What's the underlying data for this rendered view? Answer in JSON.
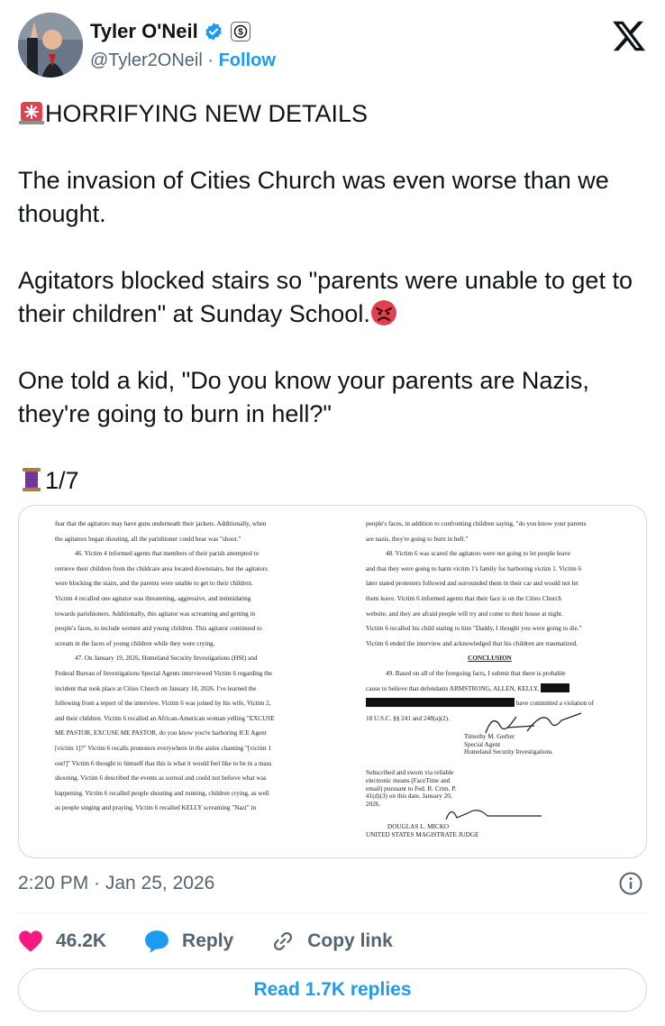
{
  "author": {
    "display_name": "Tyler O'Neil",
    "handle": "@Tyler2ONeil",
    "separator": "·",
    "follow_label": "Follow"
  },
  "tweet": {
    "line1": "HORRIFYING NEW DETAILS",
    "para2": "The invasion of Cities Church was even worse than we thought.",
    "para3": "Agitators blocked stairs so \"parents were unable to get to their children\" at Sunday School.",
    "para4": "One told a kid, \"Do you know your parents are Nazis, they're going to burn in hell?\"",
    "thread": "1/7"
  },
  "document": {
    "left": [
      "fear that the agitators may have guns underneath their jackets.  Additionally, when",
      "the agitators began shouting, all the parishioner could hear was \"shoot.\"",
      "46.   Victim 4 informed agents that members of their parish attempted to",
      "retrieve their children from the childcare area located downstairs, but the agitators",
      "were blocking the stairs, and the parents were unable to get to their children.",
      "Victim 4 recalled one agitator was threatening, aggressive, and intimidating",
      "towards parishioners.  Additionally, this agitator was screaming and getting in",
      "people's faces, to include women and young children.  This agitator continued to",
      "scream in the faces of young children while they were crying.",
      "47.   On January 19, 2026, Homeland Security Investigations (HSI) and",
      "Federal Bureau of Investigations Special Agents interviewed Victim 6 regarding the",
      "incident that took place at Cities Church on January 18, 2026.  I've learned the",
      "following from a report of the interview.  Victim 6 was joined by his wife, Victim 2,",
      "and their children.  Victim 6 recalled an African-American woman yelling \"EXCUSE",
      "ME PASTOR, EXCUSE ME PASTOR, do you know you're harboring ICE Agent",
      "[victim 1]?\"  Victim 6 recalls protesters everywhere in the aisles chanting \"[victim 1",
      "out!]\"  Victim 6 thought to himself that this is what it would feel like to be in a mass",
      "shooting.  Victim 6 described the events as surreal and could not believe what was",
      "happening.  Victim 6 recalled people shouting and running, children crying, as well",
      "as people singing and praying.  Victim 6 recalled KELLY screaming \"Nazi\" in"
    ],
    "right": [
      "people's faces, in addition to confronting children saying, \"do you know your parents",
      "are nazis, they're going to burn in hell.\"",
      "48.   Victim 6 was scared the agitators were not going to let people leave",
      "and that they were going to harm victim 1's family for harboring victim 1.  Victim 6",
      "later stated protesters followed and surrounded them in their car and would not let",
      "them leave.  Victim 6 informed agents that their face is on the Cities Church",
      "website, and they are afraid people will try and come to their house at night.",
      "Victim 6 recalled his child stating to him \"Daddy, I thought you were going to die.\"",
      "Victim 6 ended the interview and acknowledged that his children are traumatized."
    ],
    "conclusion_heading": "CONCLUSION",
    "para49_a": "49.   Based on all of the foregoing facts, I submit that there is probable",
    "para49_b": "cause to believe that defendants ARMSTRONG, ALLEN, KELLY,",
    "para49_c": "have committed a violation of",
    "para49_d": "18 U.S.C. §§ 241 and 248(a)(2).",
    "signer_name": "Timothy M. Gerber",
    "signer_title": "Special Agent",
    "signer_org": "Homeland Security Investigations",
    "sworn": [
      "Subscribed and sworn via reliable",
      "electronic means (FaceTime and",
      "email) pursuant to Fed. R. Crim. P.",
      "41(d)(3) on this date, January 20,",
      "2026."
    ],
    "judge_name": "DOUGLAS L. MICKO",
    "judge_title": "UNITED STATES MAGISTRATE JUDGE"
  },
  "meta": {
    "timestamp": "2:20 PM · Jan 25, 2026"
  },
  "actions": {
    "likes": "46.2K",
    "reply_label": "Reply",
    "copy_link_label": "Copy link",
    "read_replies_label": "Read 1.7K replies"
  },
  "colors": {
    "accent": "#1d9bf0",
    "like": "#f91880",
    "muted": "#536471"
  }
}
